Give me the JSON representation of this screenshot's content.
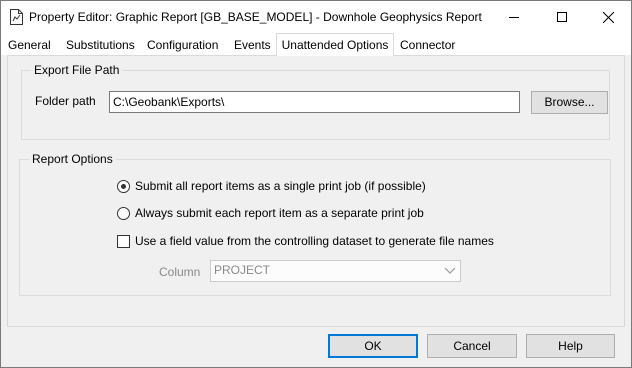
{
  "window": {
    "title": "Property Editor: Graphic Report [GB_BASE_MODEL] - Downhole Geophysics Report",
    "controls": {
      "minimize": "minimize",
      "maximize": "maximize",
      "close": "close"
    }
  },
  "tabs": [
    {
      "label": "General"
    },
    {
      "label": "Substitutions"
    },
    {
      "label": "Configuration"
    },
    {
      "label": "Events"
    },
    {
      "label": "Unattended Options",
      "active": true
    },
    {
      "label": "Connector"
    }
  ],
  "export_group": {
    "title": "Export File Path",
    "folder_label": "Folder path",
    "folder_value": "C:\\Geobank\\Exports\\",
    "browse_label": "Browse..."
  },
  "report_group": {
    "title": "Report Options",
    "option_single": "Submit all report items as a single print job (if possible)",
    "option_separate": "Always submit each report item as a separate print job",
    "selected_option": "single",
    "field_value_label": "Use a field value from the controlling dataset to generate file names",
    "field_value_checked": false,
    "column_label": "Column",
    "column_value": "PROJECT"
  },
  "buttons": {
    "ok": "OK",
    "cancel": "Cancel",
    "help": "Help"
  },
  "icons": {
    "app": "report-document-icon",
    "minimize": "minimize-icon",
    "maximize": "maximize-icon",
    "close": "close-icon",
    "dropdown": "chevron-down-icon"
  },
  "colors": {
    "default_button_border": "#0078d7"
  }
}
